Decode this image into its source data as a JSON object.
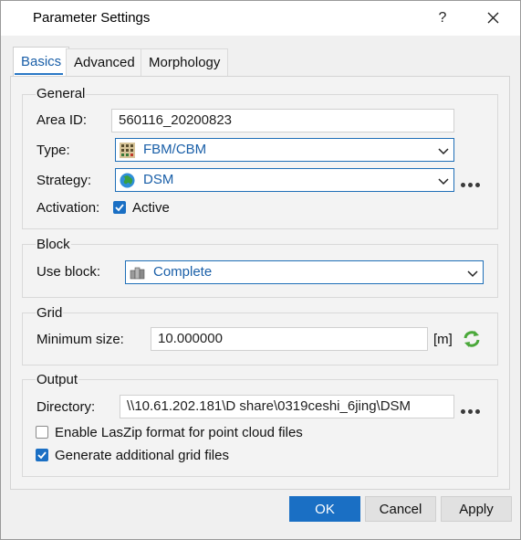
{
  "window": {
    "title": "Parameter Settings",
    "help_label": "?"
  },
  "tabs": [
    {
      "label": "Basics",
      "active": true
    },
    {
      "label": "Advanced",
      "active": false
    },
    {
      "label": "Morphology",
      "active": false
    }
  ],
  "general": {
    "title": "General",
    "area_id_label": "Area ID:",
    "area_id_value": "560116_20200823",
    "type_label": "Type:",
    "type_value": "FBM/CBM",
    "type_icon": "grid-icon",
    "strategy_label": "Strategy:",
    "strategy_value": "DSM",
    "strategy_icon": "globe-icon",
    "activation_label": "Activation:",
    "active_label": "Active",
    "active_checked": true
  },
  "block": {
    "title": "Block",
    "use_block_label": "Use block:",
    "use_block_value": "Complete",
    "use_block_icon": "blocks-icon"
  },
  "grid": {
    "title": "Grid",
    "min_size_label": "Minimum size:",
    "min_size_value": "10.000000",
    "unit": "[m]",
    "refresh_icon": "refresh-icon"
  },
  "output": {
    "title": "Output",
    "directory_label": "Directory:",
    "directory_value": "\\\\10.61.202.181\\D share\\0319ceshi_6jing\\DSM",
    "laszip_label": "Enable LasZip format for point cloud files",
    "laszip_checked": false,
    "additional_grid_label": "Generate additional grid files",
    "additional_grid_checked": true
  },
  "buttons": {
    "ok": "OK",
    "cancel": "Cancel",
    "apply": "Apply"
  },
  "colors": {
    "accent": "#1a6fc4",
    "link_text": "#1a5fa8"
  }
}
